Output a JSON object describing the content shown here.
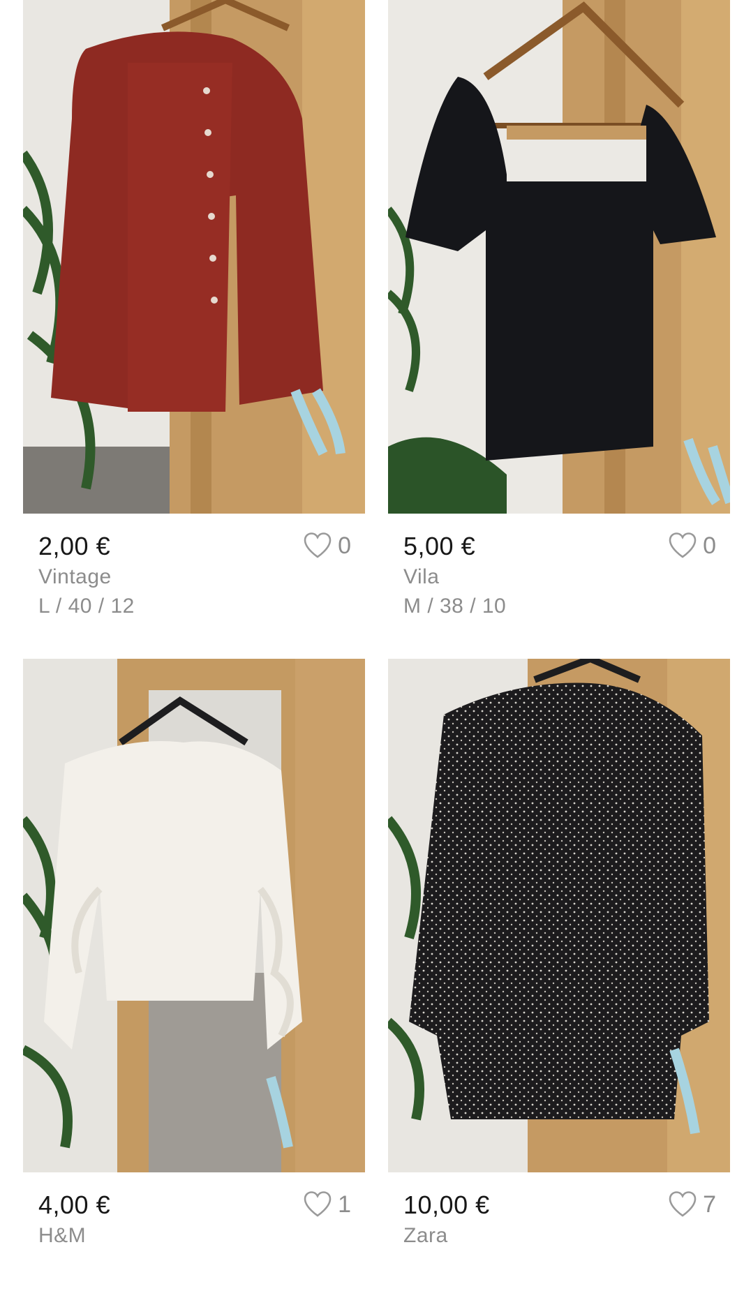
{
  "items": [
    {
      "price": "2,00 €",
      "brand": "Vintage",
      "size": "L / 40 / 12",
      "favourites": "0",
      "icon": "heart-icon",
      "garment_color": "#8e2a22"
    },
    {
      "price": "5,00 €",
      "brand": "Vila",
      "size": "M / 38 / 10",
      "favourites": "0",
      "icon": "heart-icon",
      "garment_color": "#15161a"
    },
    {
      "price": "4,00 €",
      "brand": "H&M",
      "size": "",
      "favourites": "1",
      "icon": "heart-icon",
      "garment_color": "#f3f0ea"
    },
    {
      "price": "10,00 €",
      "brand": "Zara",
      "size": "",
      "favourites": "7",
      "icon": "heart-icon",
      "garment_color": "#1c1b1d"
    }
  ],
  "colors": {
    "price_text": "#171717",
    "secondary_text": "#8c8c8c",
    "wood": "#c59a63"
  }
}
